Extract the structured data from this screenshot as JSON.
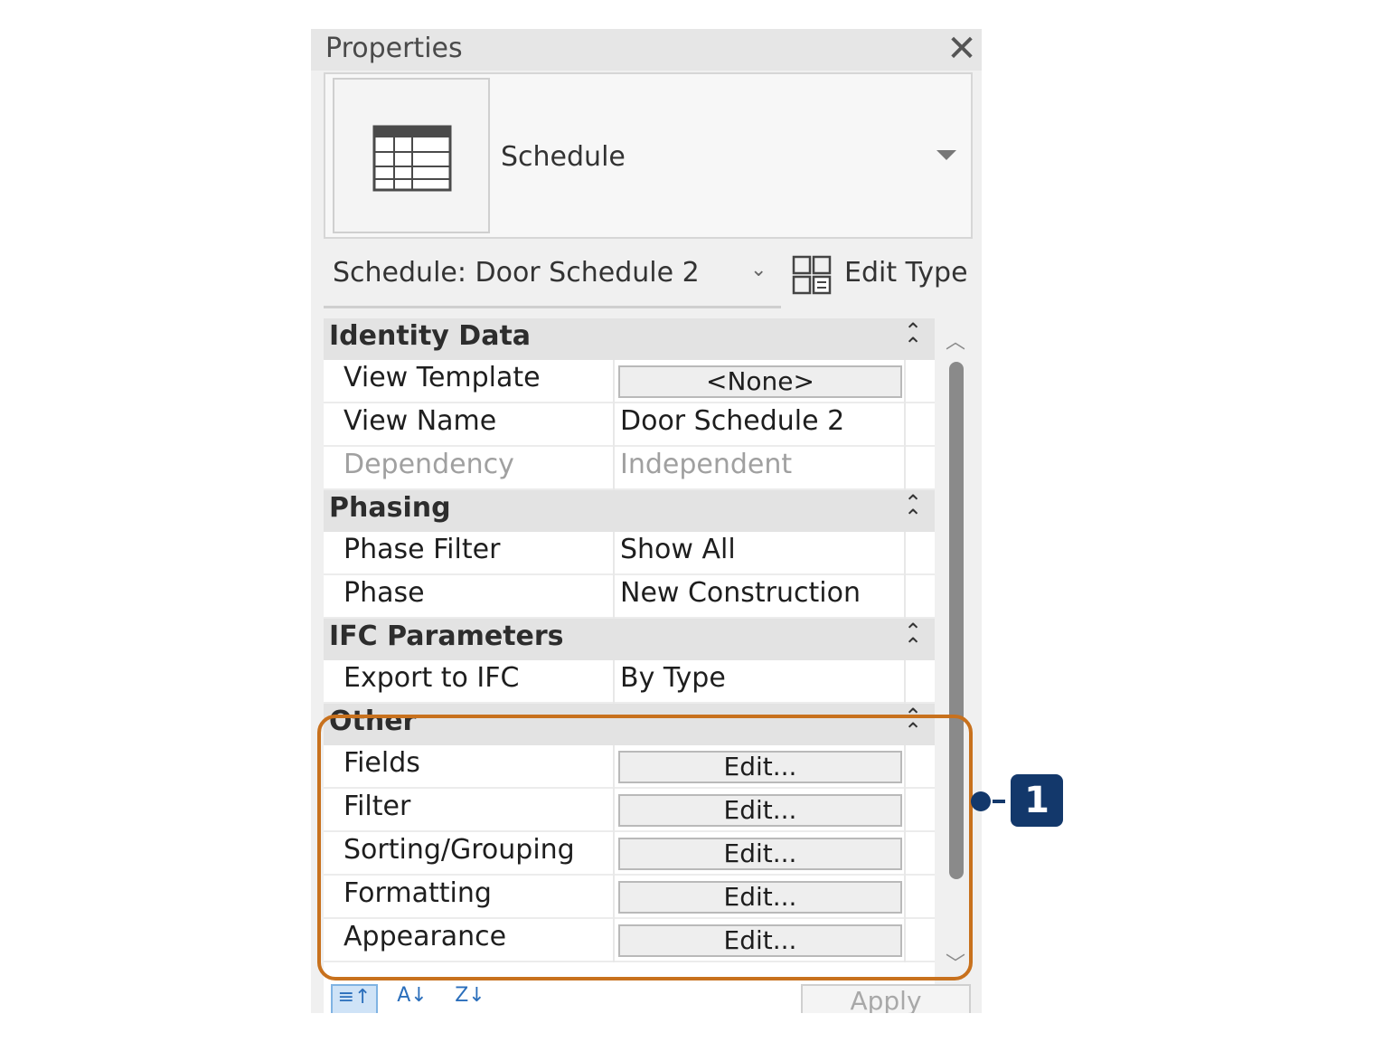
{
  "panel": {
    "title": "Properties",
    "close_glyph": "✕"
  },
  "type_selector": {
    "name": "Schedule",
    "icon": "schedule-table-icon"
  },
  "instance_selector": {
    "label": "Schedule: Door Schedule 2"
  },
  "edit_type": {
    "label": "Edit Type",
    "icon": "edit-type-icon"
  },
  "groups": [
    {
      "label": "Identity Data"
    },
    {
      "label": "Phasing"
    },
    {
      "label": "IFC Parameters"
    },
    {
      "label": "Other"
    }
  ],
  "identity": {
    "view_template": {
      "name": "View Template",
      "value": "<None>"
    },
    "view_name": {
      "name": "View Name",
      "value": "Door Schedule 2"
    },
    "dependency": {
      "name": "Dependency",
      "value": "Independent"
    }
  },
  "phasing": {
    "phase_filter": {
      "name": "Phase Filter",
      "value": "Show All"
    },
    "phase": {
      "name": "Phase",
      "value": "New Construction"
    }
  },
  "ifc": {
    "export": {
      "name": "Export to IFC",
      "value": "By Type"
    }
  },
  "other": {
    "fields": {
      "name": "Fields",
      "value": "Edit..."
    },
    "filter": {
      "name": "Filter",
      "value": "Edit..."
    },
    "sorting": {
      "name": "Sorting/Grouping",
      "value": "Edit..."
    },
    "formatting": {
      "name": "Formatting",
      "value": "Edit..."
    },
    "appearance": {
      "name": "Appearance",
      "value": "Edit..."
    }
  },
  "footer": {
    "apply_label": "Apply"
  },
  "callout": {
    "number": "1",
    "color": "#13386b",
    "highlight_color": "#c8711d"
  }
}
